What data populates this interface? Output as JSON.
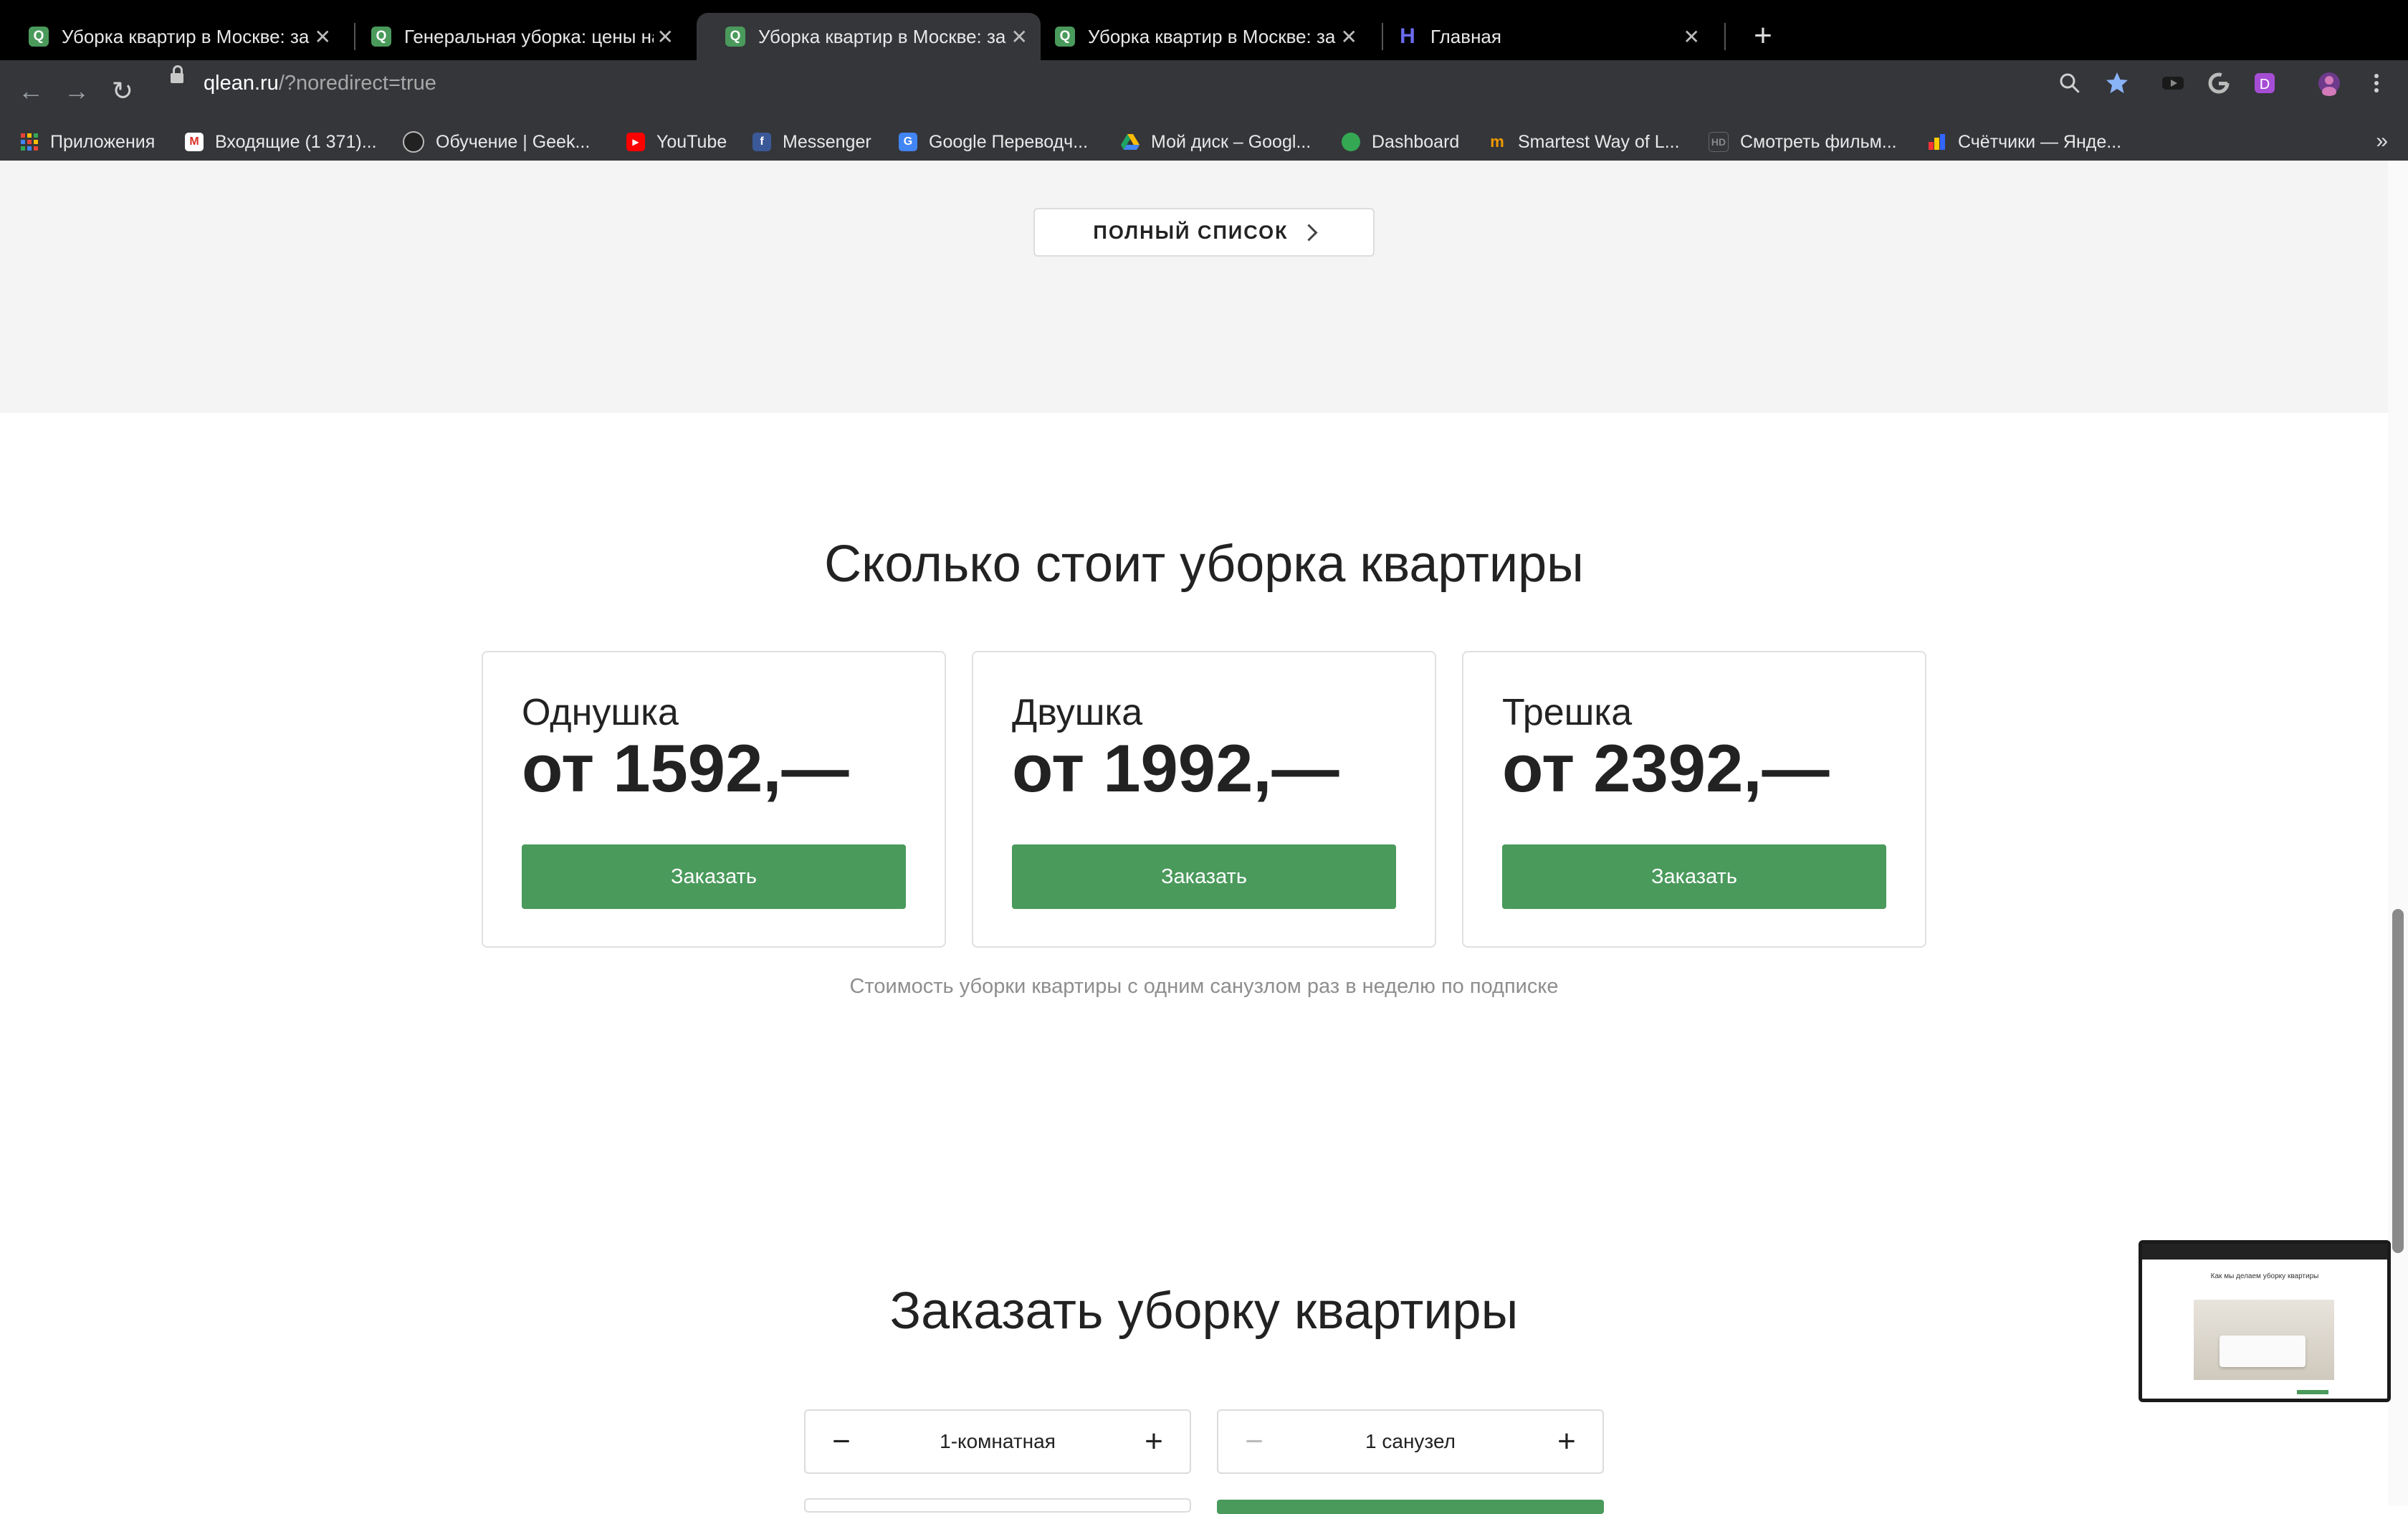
{
  "browser": {
    "tabs": [
      {
        "title": "Уборка квартир в Москве: за",
        "favicon": "Q",
        "active": false
      },
      {
        "title": "Генеральная уборка: цены на",
        "favicon": "Q",
        "active": false
      },
      {
        "title": "Уборка квартир в Москве: за",
        "favicon": "Q",
        "active": true
      },
      {
        "title": "Уборка квартир в Москве: за",
        "favicon": "Q",
        "active": false
      },
      {
        "title": "Главная",
        "favicon": "H",
        "active": false
      }
    ],
    "close_glyph": "✕",
    "new_tab_glyph": "+",
    "address": {
      "host": "qlean.ru",
      "path": "/?noredirect=true"
    },
    "nav": {
      "back": "←",
      "forward": "→",
      "reload": "↻"
    },
    "bookmarks": [
      {
        "label": "Приложения",
        "icon": "apps-grid-icon",
        "color": "#e8453c"
      },
      {
        "label": "Входящие (1 371)...",
        "icon": "gmail-icon",
        "color": "#d93025"
      },
      {
        "label": "Обучение | Geek...",
        "icon": "geekbrains-icon",
        "color": "#444444"
      },
      {
        "label": "YouTube",
        "icon": "youtube-icon",
        "color": "#ff0000"
      },
      {
        "label": "Messenger",
        "icon": "facebook-icon",
        "color": "#3b5998"
      },
      {
        "label": "Google Переводч...",
        "icon": "google-translate-icon",
        "color": "#4285f4"
      },
      {
        "label": "Мой диск – Googl...",
        "icon": "google-drive-icon",
        "color": "#1fa463"
      },
      {
        "label": "Dashboard",
        "icon": "dashboard-icon",
        "color": "#34a853"
      },
      {
        "label": "Smartest Way of L...",
        "icon": "smartest-way-icon",
        "color": "#f29900"
      },
      {
        "label": "Смотреть фильм...",
        "icon": "hd-icon",
        "color": "#666666"
      },
      {
        "label": "Счётчики — Янде...",
        "icon": "yandex-metrica-icon",
        "color": "#ffcc00"
      }
    ],
    "bookmarks_more": "»"
  },
  "page": {
    "full_list_button": "ПОЛНЫЙ СПИСОК",
    "pricing": {
      "title": "Сколько стоит уборка квартиры",
      "cards": [
        {
          "name": "Однушка",
          "price": "от 1592,—",
          "button": "Заказать"
        },
        {
          "name": "Двушка",
          "price": "от 1992,—",
          "button": "Заказать"
        },
        {
          "name": "Трешка",
          "price": "от 2392,—",
          "button": "Заказать"
        }
      ],
      "note": "Стоимость уборки квартиры с одним санузлом раз в неделю по подписке"
    },
    "order": {
      "title": "Заказать уборку квартиры",
      "rooms": {
        "value": "1-комнатная",
        "minus": "−",
        "plus": "+"
      },
      "bathrooms": {
        "value": "1 санузел",
        "minus": "−",
        "plus": "+"
      }
    },
    "pip_preview": {
      "title": "Как мы делаем уборку квартиры"
    }
  },
  "colors": {
    "accent_green": "#4a9a5c",
    "chrome_dark": "#35363a"
  }
}
